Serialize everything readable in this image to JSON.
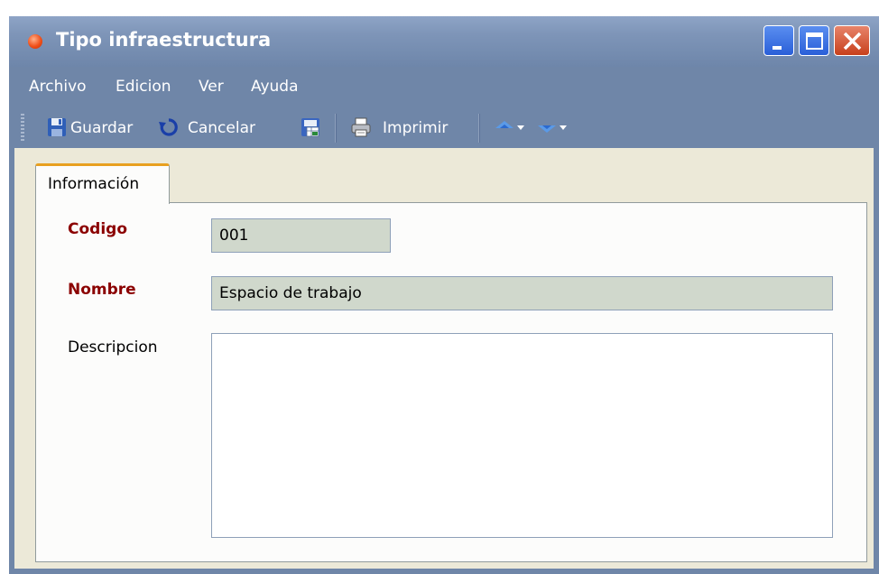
{
  "window": {
    "title": "Tipo infraestructura"
  },
  "menu": {
    "items": [
      {
        "label": "Archivo"
      },
      {
        "label": "Edicion"
      },
      {
        "label": "Ver"
      },
      {
        "label": "Ayuda"
      }
    ]
  },
  "toolbar": {
    "save_label": "Guardar",
    "cancel_label": "Cancelar",
    "print_label": "Imprimir"
  },
  "tabs": [
    {
      "label": "Información",
      "selected": true
    }
  ],
  "form": {
    "codigo": {
      "label": "Codigo",
      "value": "001",
      "required": true
    },
    "nombre": {
      "label": "Nombre",
      "value": "Espacio de trabajo",
      "required": true
    },
    "descripcion": {
      "label": "Descripcion",
      "value": "",
      "required": false
    }
  },
  "icons": {
    "title": "status-dot-icon",
    "save": "floppy-disk-icon",
    "cancel": "undo-arrow-icon",
    "export": "document-spreadsheet-icon",
    "print": "printer-icon",
    "nav_up": "arrow-up-icon",
    "nav_down": "arrow-down-icon"
  },
  "colors": {
    "titlebar": "#7e95b8",
    "required_label": "#8b0000",
    "input_readonly_bg": "#d0d8cc",
    "tab_accent": "#e8a020",
    "client_bg": "#ece9d8"
  }
}
